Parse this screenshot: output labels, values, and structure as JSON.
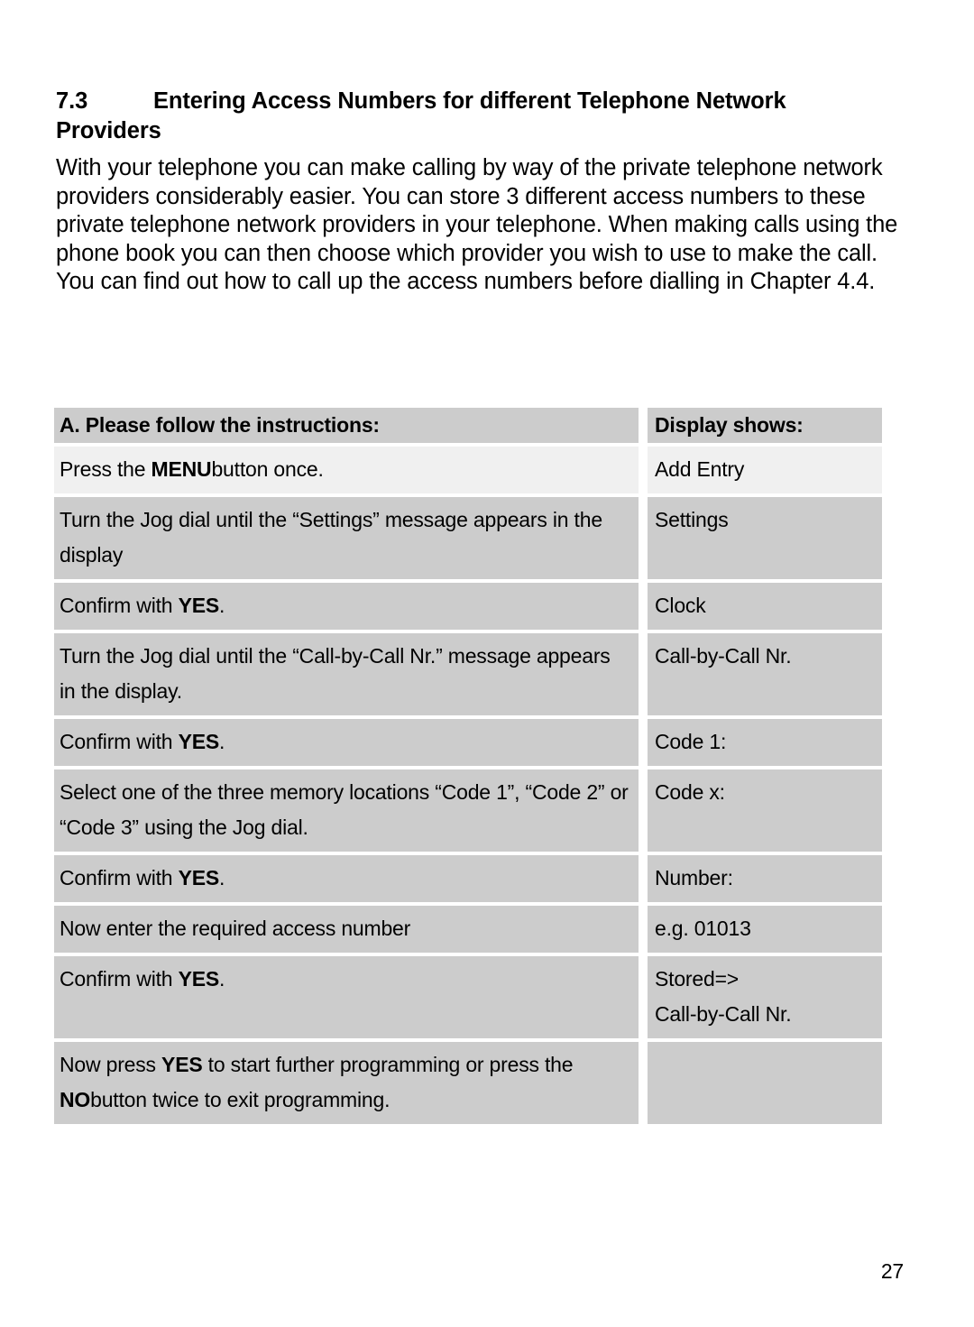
{
  "document": {
    "section_number": "7.3",
    "section_title": "Entering Access Numbers for different Telephone Network Providers",
    "intro_paragraph": "With your telephone you can make calling by way of the private telephone network providers considerably easier. You can store 3 different access numbers to these private telephone network providers in your telephone. When making calls using the phone book you can then choose which provider you wish to use to make the call. You can find out how to call up the access numbers before dialling in Chapter 4.4.",
    "page_number": "27"
  },
  "table": {
    "headers": {
      "instructions": "A. Please follow the instructions:",
      "display": "Display shows:"
    },
    "rows": [
      {
        "instruction_pre": "Press the ",
        "instruction_bold": "MENU",
        "instruction_post": "button once.",
        "display": "Add Entry",
        "shade": "light"
      },
      {
        "instruction_pre": "Turn the Jog dial until the “Settings” message appears in the display",
        "instruction_bold": "",
        "instruction_post": "",
        "display": "Settings",
        "shade": "dark"
      },
      {
        "instruction_pre": "Confirm with ",
        "instruction_bold": "YES",
        "instruction_post": ".",
        "display": "Clock",
        "shade": "dark"
      },
      {
        "instruction_pre": "Turn the Jog dial until the “Call-by-Call Nr.” message appears in the display.",
        "instruction_bold": "",
        "instruction_post": "",
        "display": "Call-by-Call Nr.",
        "shade": "dark"
      },
      {
        "instruction_pre": "Confirm with ",
        "instruction_bold": "YES",
        "instruction_post": ".",
        "display": "Code 1:",
        "shade": "dark"
      },
      {
        "instruction_pre": "Select one of the three memory locations “Code 1”, “Code 2” or “Code 3” using the Jog dial.",
        "instruction_bold": "",
        "instruction_post": "",
        "display": "Code x:",
        "shade": "dark"
      },
      {
        "instruction_pre": "Confirm with ",
        "instruction_bold": "YES",
        "instruction_post": ".",
        "display": "Number:",
        "shade": "dark"
      },
      {
        "instruction_pre": "Now enter the required access number",
        "instruction_bold": "",
        "instruction_post": "",
        "display": " e.g. 01013",
        "shade": "dark"
      },
      {
        "instruction_pre": "Confirm with ",
        "instruction_bold": "YES",
        "instruction_post": ".",
        "display": "Stored=>\nCall-by-Call Nr.",
        "shade": "dark"
      },
      {
        "instruction_pre": "Now press ",
        "instruction_bold": "YES",
        "instruction_post": " to start further programming or press the ",
        "instruction_bold2": "NO",
        "instruction_post2": "button twice to exit programming.",
        "display": "",
        "shade": "dark",
        "display_shade": "dark"
      }
    ]
  }
}
